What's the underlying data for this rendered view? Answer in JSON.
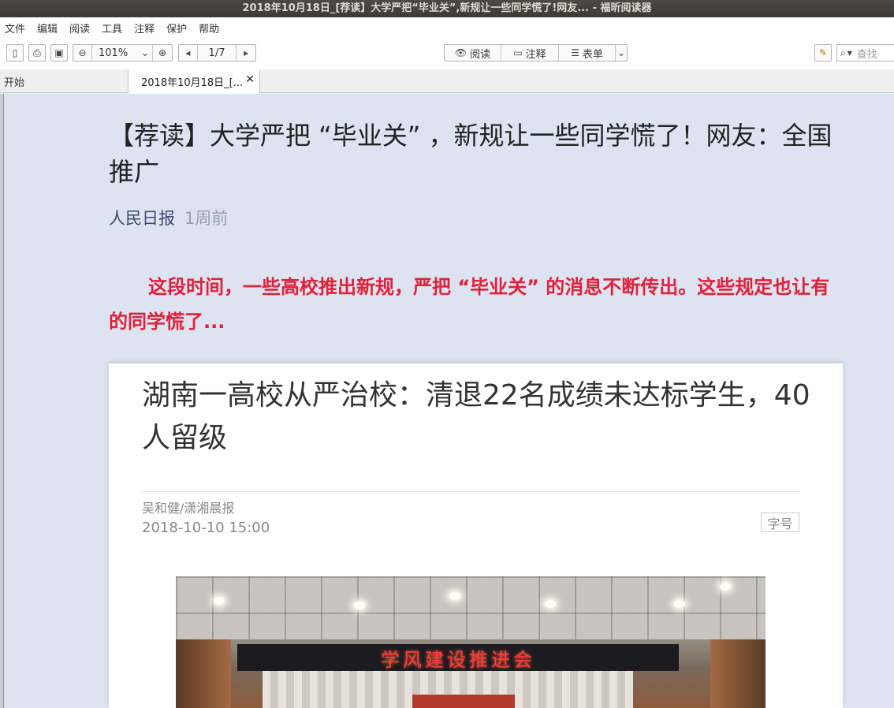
{
  "window": {
    "title": "2018年10月18日_[荐读】大学严把“毕业关”,新规让一些同学慌了!网友... - 福昕阅读器"
  },
  "menu": [
    "文件",
    "编辑",
    "阅读",
    "工具",
    "注释",
    "保护",
    "帮助"
  ],
  "toolbar": {
    "zoom": "101%",
    "page": "1/7",
    "read_label": "阅读",
    "annot_label": "注释",
    "form_label": "表单",
    "search_placeholder": "查找"
  },
  "tabs": {
    "start": "开始",
    "doc": "2018年10月18日_[..."
  },
  "article": {
    "title": "【荐读】大学严把 “毕业关” ，新规让一些同学慌了！网友：全国推广",
    "source": "人民日报",
    "time": "1周前",
    "lead": "这段时间，一些高校推出新规，严把 “毕业关” 的消息不断传出。这些规定也让有的同学慌了..."
  },
  "embedded": {
    "title": "湖南一高校从严治校：清退22名成绩未达标学生，40人留级",
    "author": "吴和健/潇湘晨报",
    "date": "2018-10-10 15:00",
    "font_button": "字号",
    "banner": "学风建设推进会"
  },
  "colors": {
    "lead": "#e0213b",
    "doc_bg": "#dde3f0"
  }
}
